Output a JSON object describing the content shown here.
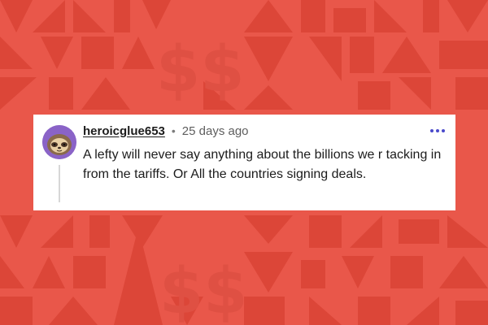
{
  "comment": {
    "username": "heroicglue653",
    "separator": "•",
    "timestamp": "25 days ago",
    "body": "A lefty will never say anything about the billions we r tacking in from the tariffs. Or All the countries signing deals."
  },
  "icons": {
    "avatar": "sloth-avatar-icon",
    "more": "more-options-icon"
  },
  "colors": {
    "background": "#e9574a",
    "pattern": "#df4a3d",
    "card": "#ffffff",
    "avatar_bg": "#8a63c7",
    "more_dots": "#4a4acb",
    "text": "#1c1c1c",
    "muted": "#5e5e5e"
  }
}
